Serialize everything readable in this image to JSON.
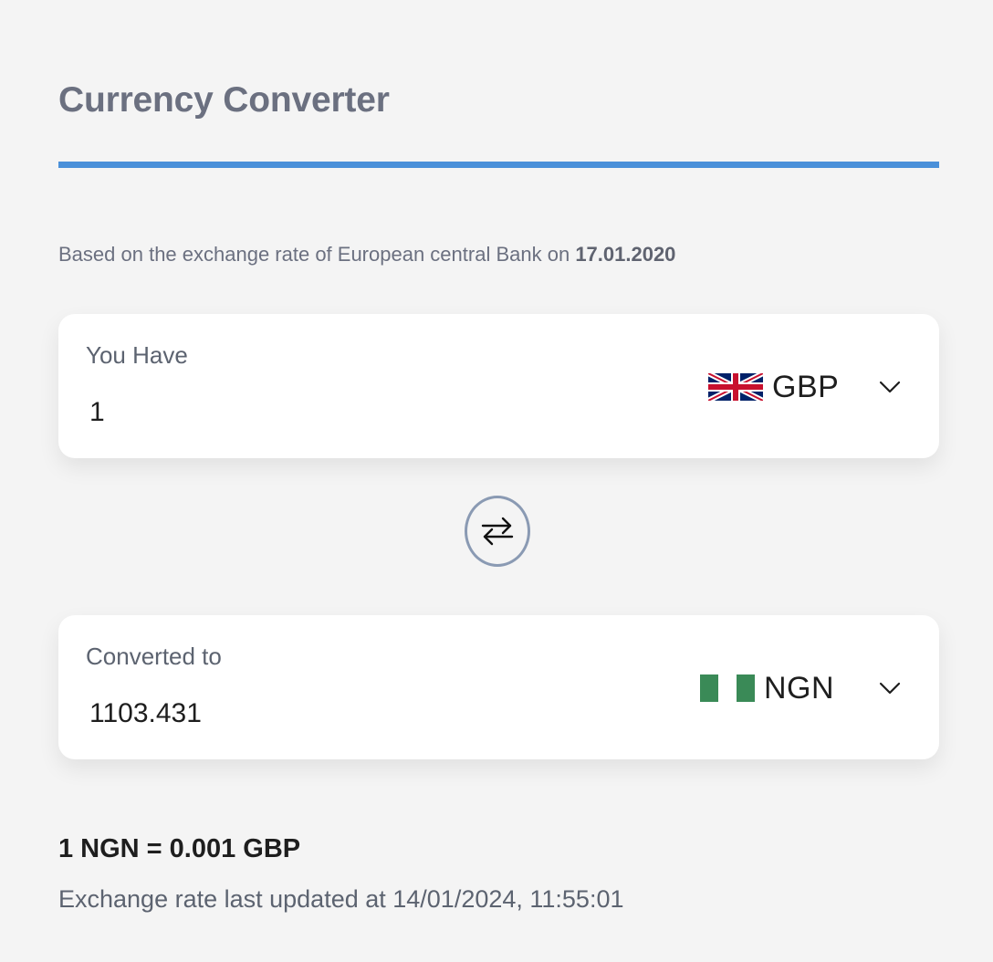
{
  "header": {
    "title": "Currency Converter",
    "accent_color": "#4a90d9"
  },
  "rate_source": {
    "prefix": "Based on the exchange rate of European central Bank on",
    "date": "17.01.2020"
  },
  "from_card": {
    "label": "You Have",
    "value": "1",
    "currency": {
      "code": "GBP",
      "flag_icon": "uk-flag-icon"
    },
    "dropdown_icon": "chevron-down-icon"
  },
  "swap": {
    "icon": "swap-arrows-icon",
    "border_color": "#8a9ab3"
  },
  "to_card": {
    "label": "Converted to",
    "value": "1103.431",
    "currency": {
      "code": "NGN",
      "flag_icon": "nigeria-flag-icon",
      "flag_color": "#3a8a57"
    },
    "dropdown_icon": "chevron-down-icon"
  },
  "footer": {
    "rate": "1 NGN = 0.001 GBP",
    "updated": "Exchange rate last updated at 14/01/2024, 11:55:01"
  }
}
